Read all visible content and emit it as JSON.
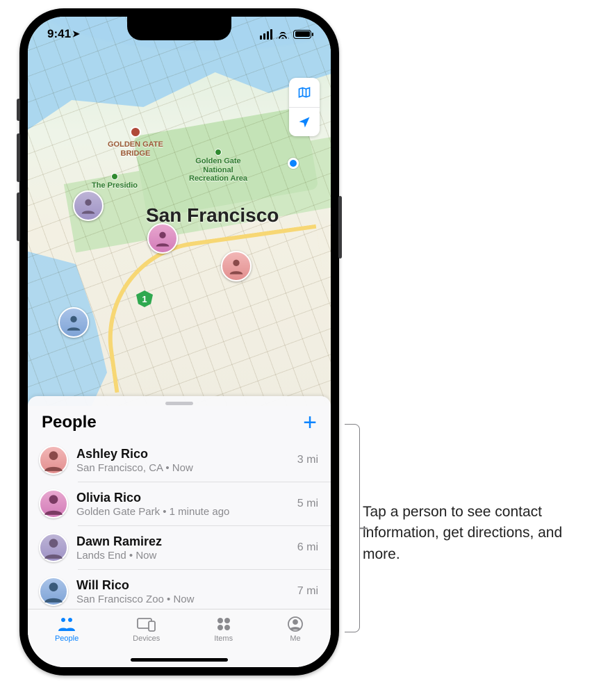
{
  "status": {
    "time": "9:41"
  },
  "map": {
    "city_label": "San Francisco",
    "highway_shield": "1",
    "poi": {
      "bridge": "GOLDEN GATE\nBRIDGE",
      "ggnra": "Golden Gate\nNational\nRecreation Area",
      "presidio": "The Presidio"
    }
  },
  "sheet": {
    "title": "People",
    "people": [
      {
        "name": "Ashley Rico",
        "sub": "San Francisco, CA • Now",
        "dist": "3 mi",
        "color": "linear-gradient(#f2b7b7,#e28e8e)"
      },
      {
        "name": "Olivia Rico",
        "sub": "Golden Gate Park • 1 minute ago",
        "dist": "5 mi",
        "color": "linear-gradient(#e8a7cf,#d27bb8)"
      },
      {
        "name": "Dawn Ramirez",
        "sub": "Lands End • Now",
        "dist": "6 mi",
        "color": "linear-gradient(#bdb4d6,#9e92c5)"
      },
      {
        "name": "Will Rico",
        "sub": "San Francisco Zoo • Now",
        "dist": "7 mi",
        "color": "linear-gradient(#a9c3e8,#7ea3d6)"
      }
    ]
  },
  "tabs": {
    "people": "People",
    "devices": "Devices",
    "items": "Items",
    "me": "Me"
  },
  "callout": "Tap a person to see contact information, get directions, and more."
}
